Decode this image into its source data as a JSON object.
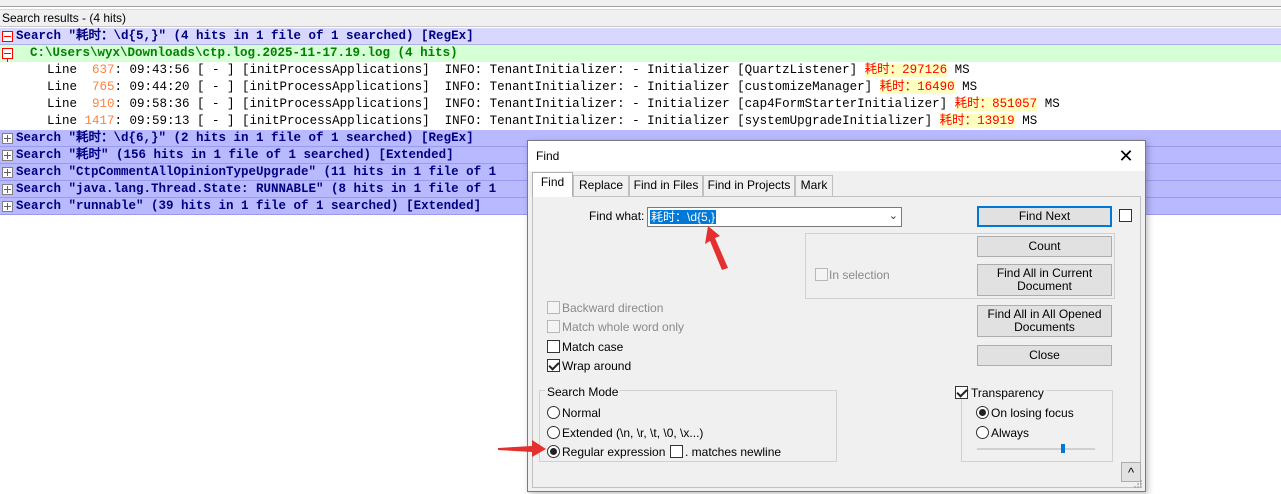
{
  "results": {
    "header": "Search results - (4 hits)",
    "searches": [
      {
        "label": "Search \"耗时：\\d{5,}\" (4 hits in 1 file of 1 searched) [RegEx]",
        "expanded": true,
        "file": "C:\\Users\\wyx\\Downloads\\ctp.log.2025-11-17.19.log (4 hits)",
        "lines": [
          {
            "prefix": "Line ",
            "lineno": " 637",
            "pre": ": 09:43:56 [ - ] [initProcessApplications]  INFO: TenantInitializer: - Initializer [QuartzListener] ",
            "hit": "耗时：297126",
            "post": " MS"
          },
          {
            "prefix": "Line ",
            "lineno": " 765",
            "pre": ": 09:44:20 [ - ] [initProcessApplications]  INFO: TenantInitializer: - Initializer [customizeManager] ",
            "hit": "耗时：16490",
            "post": " MS"
          },
          {
            "prefix": "Line ",
            "lineno": " 910",
            "pre": ": 09:58:36 [ - ] [initProcessApplications]  INFO: TenantInitializer: - Initializer [cap4FormStarterInitializer] ",
            "hit": "耗时：851057",
            "post": " MS"
          },
          {
            "prefix": "Line ",
            "lineno": "1417",
            "pre": ": 09:59:13 [ - ] [initProcessApplications]  INFO: TenantInitializer: - Initializer [systemUpgradeInitializer] ",
            "hit": "耗时：13919",
            "post": " MS"
          }
        ]
      },
      {
        "label": "Search \"耗时：\\d{6,}\" (2 hits in 1 file of 1 searched) [RegEx]",
        "expanded": false
      },
      {
        "label": "Search \"耗时\" (156 hits in 1 file of 1 searched) [Extended]",
        "expanded": false
      },
      {
        "label": "Search \"CtpCommentAllOpinionTypeUpgrade\" (11 hits in 1 file of 1",
        "expanded": false
      },
      {
        "label": "Search \"java.lang.Thread.State: RUNNABLE\" (8 hits in 1 file of 1",
        "expanded": false
      },
      {
        "label": "Search \"runnable\" (39 hits in 1 file of 1 searched) [Extended]",
        "expanded": false
      }
    ]
  },
  "dialog": {
    "title": "Find",
    "close_glyph": "✕",
    "tabs": [
      "Find",
      "Replace",
      "Find in Files",
      "Find in Projects",
      "Mark"
    ],
    "active_tab": "Find",
    "find_what_label": "Find what:",
    "find_what_value": "耗时：\\d{5,}",
    "in_selection": "In selection",
    "backward_direction": "Backward direction",
    "match_whole_word": "Match whole word only",
    "match_case": "Match case",
    "wrap_around": "Wrap around",
    "wrap_around_checked": true,
    "search_mode_title": "Search Mode",
    "modes": [
      "Normal",
      "Extended (\\n, \\r, \\t, \\0, \\x...)",
      "Regular expression"
    ],
    "selected_mode": "Regular expression",
    "matches_newline": ". matches newline",
    "buttons": {
      "find_next": "Find Next",
      "count": "Count",
      "find_all_current": "Find All in Current Document",
      "find_all_opened": "Find All in All Opened Documents",
      "close": "Close"
    },
    "transparency": "Transparency",
    "transparency_checked": true,
    "on_losing_focus": "On losing focus",
    "always": "Always",
    "transparency_selected": "On losing focus",
    "transparency_level": 0.71,
    "collapse_glyph": "^"
  }
}
